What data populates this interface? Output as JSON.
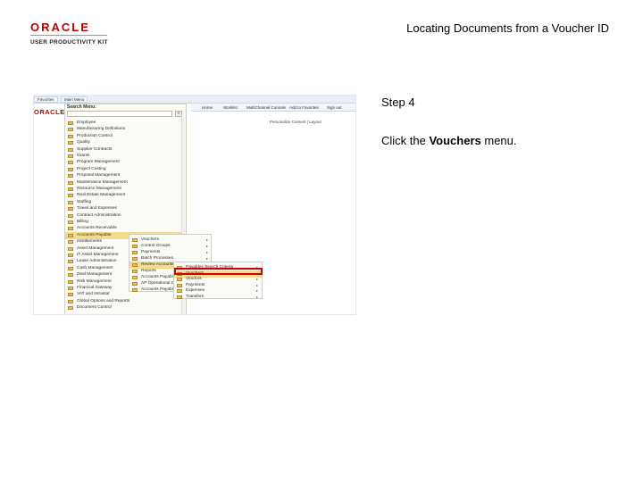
{
  "header": {
    "logo_text": "ORACLE",
    "logo_subtitle": "USER PRODUCTIVITY KIT",
    "doc_title": "Locating Documents from a Voucher ID"
  },
  "step": {
    "label": "Step 4",
    "instruction_prefix": "Click the ",
    "instruction_target": "Vouchers",
    "instruction_suffix": " menu."
  },
  "screenshot": {
    "tabs": [
      "Favorites",
      "Main Menu"
    ],
    "logo_text": "ORACLE",
    "nav_links": [
      "Home",
      "Worklist",
      "MultiChannel Console",
      "Add to Favorites",
      "Sign out"
    ],
    "add_favorites": "Personalize Content | Layout",
    "search_label": "Search Menu:",
    "search_go": "»",
    "main_menu_items": [
      {
        "label": "Employee"
      },
      {
        "label": "Manufacturing Definitions"
      },
      {
        "label": "Production Control"
      },
      {
        "label": "Quality"
      },
      {
        "label": "Supplier Contracts",
        "arrow": true
      },
      {
        "label": "Grants",
        "arrow": true
      },
      {
        "label": "Program Management",
        "arrow": true
      },
      {
        "label": "Project Costing",
        "arrow": true
      },
      {
        "label": "Proposal Management"
      },
      {
        "label": "Maintenance Management"
      },
      {
        "label": "Resource Management",
        "arrow": true
      },
      {
        "label": "Real Estate Management",
        "arrow": true
      },
      {
        "label": "Staffing",
        "arrow": true
      },
      {
        "label": "Travel and Expenses",
        "arrow": true
      },
      {
        "label": "Contract Administration"
      },
      {
        "label": "Billing",
        "arrow": true
      },
      {
        "label": "Accounts Receivable",
        "arrow": true
      },
      {
        "label": "Accounts Payable",
        "arrow": true,
        "highlight": true
      },
      {
        "label": "eSettlements",
        "arrow": true
      },
      {
        "label": "Asset Management",
        "arrow": true
      },
      {
        "label": "IT Asset Management",
        "arrow": true
      },
      {
        "label": "Lease Administration"
      },
      {
        "label": "Cash Management",
        "arrow": true
      },
      {
        "label": "Deal Management",
        "arrow": true
      },
      {
        "label": "Risk Management",
        "arrow": true
      },
      {
        "label": "Financial Gateway",
        "arrow": true
      },
      {
        "label": "VAT and Intrastat",
        "arrow": true
      },
      {
        "label": "Global Options and Reports",
        "arrow": true
      },
      {
        "label": "Document Control"
      }
    ],
    "submenu_1": [
      {
        "label": "Vouchers",
        "arrow": true
      },
      {
        "label": "Control Groups",
        "arrow": true
      },
      {
        "label": "Payments",
        "arrow": true
      },
      {
        "label": "Batch Processes",
        "arrow": true
      },
      {
        "label": "Review Accounts Payable Info",
        "arrow": true,
        "highlight": true
      },
      {
        "label": "Reports",
        "arrow": true
      },
      {
        "label": "Accounts Payable WorkCenter",
        "arrow": true
      },
      {
        "label": "AP Operational Dashboard",
        "arrow": true
      },
      {
        "label": "Accounts Payable Dashboard",
        "arrow": true
      }
    ],
    "submenu_2": [
      {
        "label": "Payables Search Criteria",
        "arrow": true
      },
      {
        "label": "Vouchers",
        "arrow": true,
        "highlight": true
      },
      {
        "label": "Vendors",
        "arrow": true
      },
      {
        "label": "Payments",
        "arrow": true
      },
      {
        "label": "Expenses",
        "arrow": true
      },
      {
        "label": "Transfers",
        "arrow": true
      }
    ]
  },
  "colors": {
    "oracle_red": "#c00000",
    "callout_red": "#d40000",
    "menu_highlight": "#f4dc8a",
    "folder": "#e8c060"
  },
  "icons": [
    "folder-icon",
    "chevron-right-icon"
  ]
}
